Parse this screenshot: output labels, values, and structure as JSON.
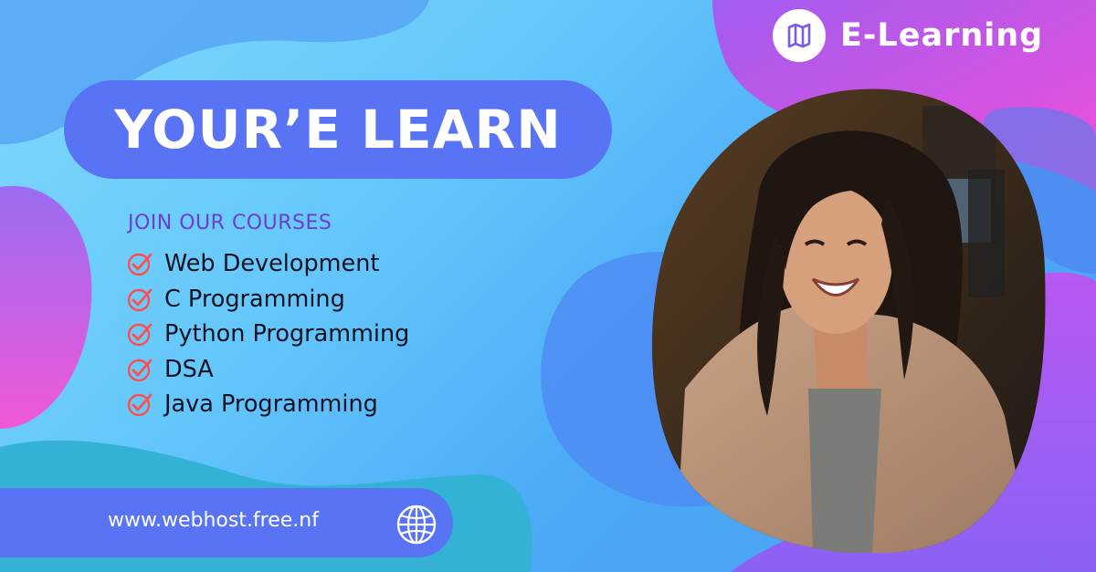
{
  "brand": {
    "name": "E-Learning",
    "logo_icon": "map-icon"
  },
  "headline": "YOUR’E LEARN",
  "courses": {
    "heading": "JOIN OUR COURSES",
    "items": [
      "Web Development",
      "C Programming",
      "Python Programming",
      "DSA",
      "Java Programming"
    ]
  },
  "footer": {
    "url": "www.webhost.free.nf",
    "globe_icon": "globe-icon"
  },
  "colors": {
    "pill": "#5873f3",
    "check": "#ff4d4d",
    "magenta": "#e04fe0",
    "subhead": "#6a3fd0"
  }
}
